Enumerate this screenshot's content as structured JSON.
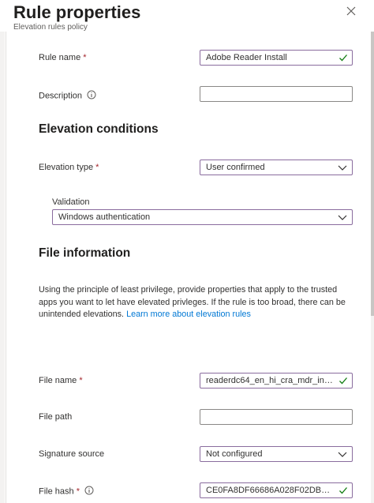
{
  "header": {
    "title": "Rule properties",
    "subtitle": "Elevation rules policy"
  },
  "rule_name": {
    "label": "Rule name",
    "required_mark": "*",
    "value": "Adobe Reader Install"
  },
  "description": {
    "label": "Description",
    "value": ""
  },
  "elevation_section": {
    "title": "Elevation conditions"
  },
  "elevation_type": {
    "label": "Elevation type",
    "required_mark": "*",
    "value": "User confirmed"
  },
  "validation": {
    "label": "Validation",
    "value": "Windows authentication"
  },
  "file_section": {
    "title": "File information",
    "paragraph": "Using the principle of least privilege, provide properties that apply to the trusted apps you want to let have elevated privleges. If the rule is too broad, there can be unintended elevations.",
    "link": "Learn more about elevation rules"
  },
  "file_name": {
    "label": "File name",
    "required_mark": "*",
    "value": "readerdc64_en_hi_cra_mdr_install.e..."
  },
  "file_path": {
    "label": "File path",
    "value": ""
  },
  "signature_source": {
    "label": "Signature source",
    "value": "Not configured"
  },
  "file_hash": {
    "label": "File hash",
    "required_mark": "*",
    "value": "CE0FA8DF66686A028F02DBA185F..."
  },
  "icons": {
    "close": "close-icon",
    "info": "info-icon",
    "check": "checkmark-icon",
    "dropdown": "chevron-down-icon"
  },
  "colors": {
    "required": "#a4262c",
    "link": "#0078d4",
    "valid_check": "#107c10",
    "focus_border": "#8a6c9e"
  }
}
